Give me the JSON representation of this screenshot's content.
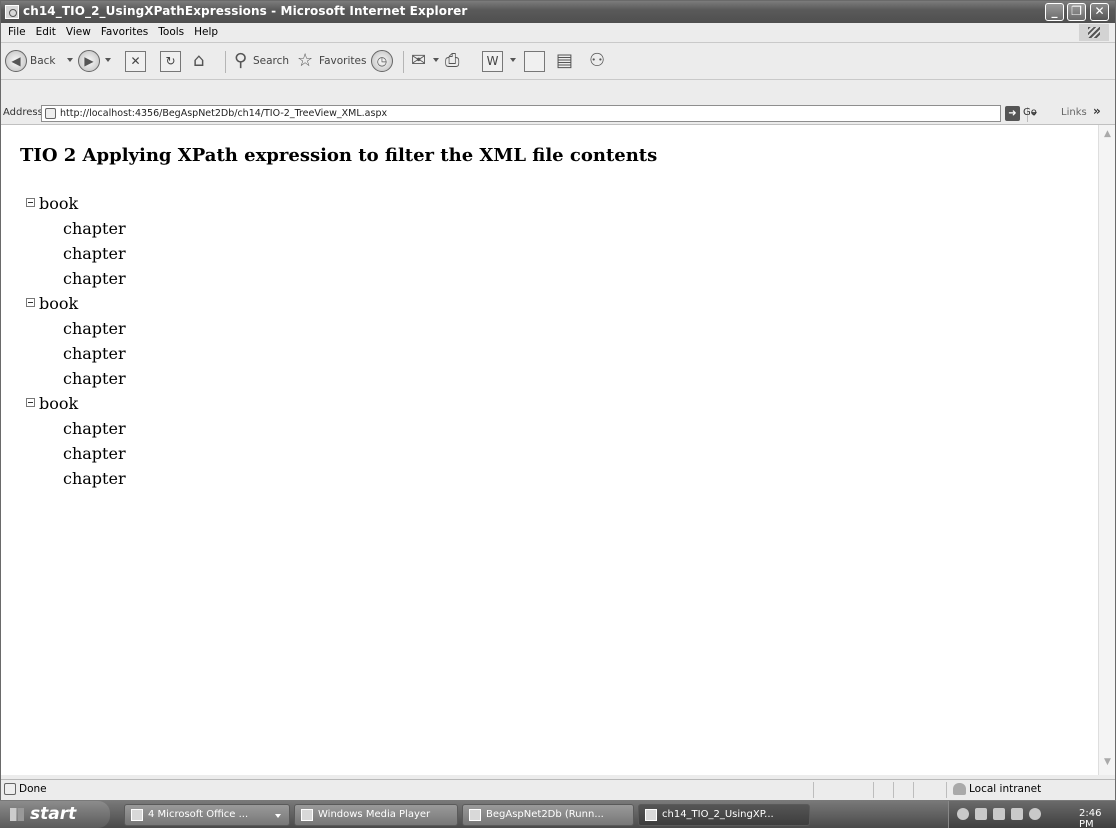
{
  "window": {
    "title": "ch14_TIO_2_UsingXPathExpressions - Microsoft Internet Explorer",
    "min_glyph": "_",
    "max_glyph": "❐",
    "close_glyph": "✕"
  },
  "menu": [
    "File",
    "Edit",
    "View",
    "Favorites",
    "Tools",
    "Help"
  ],
  "toolbar": {
    "back_label": "Back",
    "search_label": "Search",
    "favorites_label": "Favorites"
  },
  "address": {
    "label": "Address",
    "url": "http://localhost:4356/BegAspNet2Db/ch14/TIO-2_TreeView_XML.aspx",
    "go_label": "Go",
    "links_label": "Links",
    "links_chevron": "»"
  },
  "page": {
    "heading": "TIO 2 Applying XPath expression to filter the XML file contents",
    "tree": [
      {
        "label": "book",
        "children": [
          "chapter",
          "chapter",
          "chapter"
        ]
      },
      {
        "label": "book",
        "children": [
          "chapter",
          "chapter",
          "chapter"
        ]
      },
      {
        "label": "book",
        "children": [
          "chapter",
          "chapter",
          "chapter"
        ]
      }
    ]
  },
  "status": {
    "text": "Done",
    "zone": "Local intranet"
  },
  "taskbar": {
    "start_label": "start",
    "tasks": [
      {
        "label": "4 Microsoft Office ...",
        "active": false
      },
      {
        "label": "Windows Media Player",
        "active": false
      },
      {
        "label": "BegAspNet2Db (Runn...",
        "active": false
      },
      {
        "label": "ch14_TIO_2_UsingXP...",
        "active": true
      }
    ],
    "clock": "2:46 PM"
  }
}
